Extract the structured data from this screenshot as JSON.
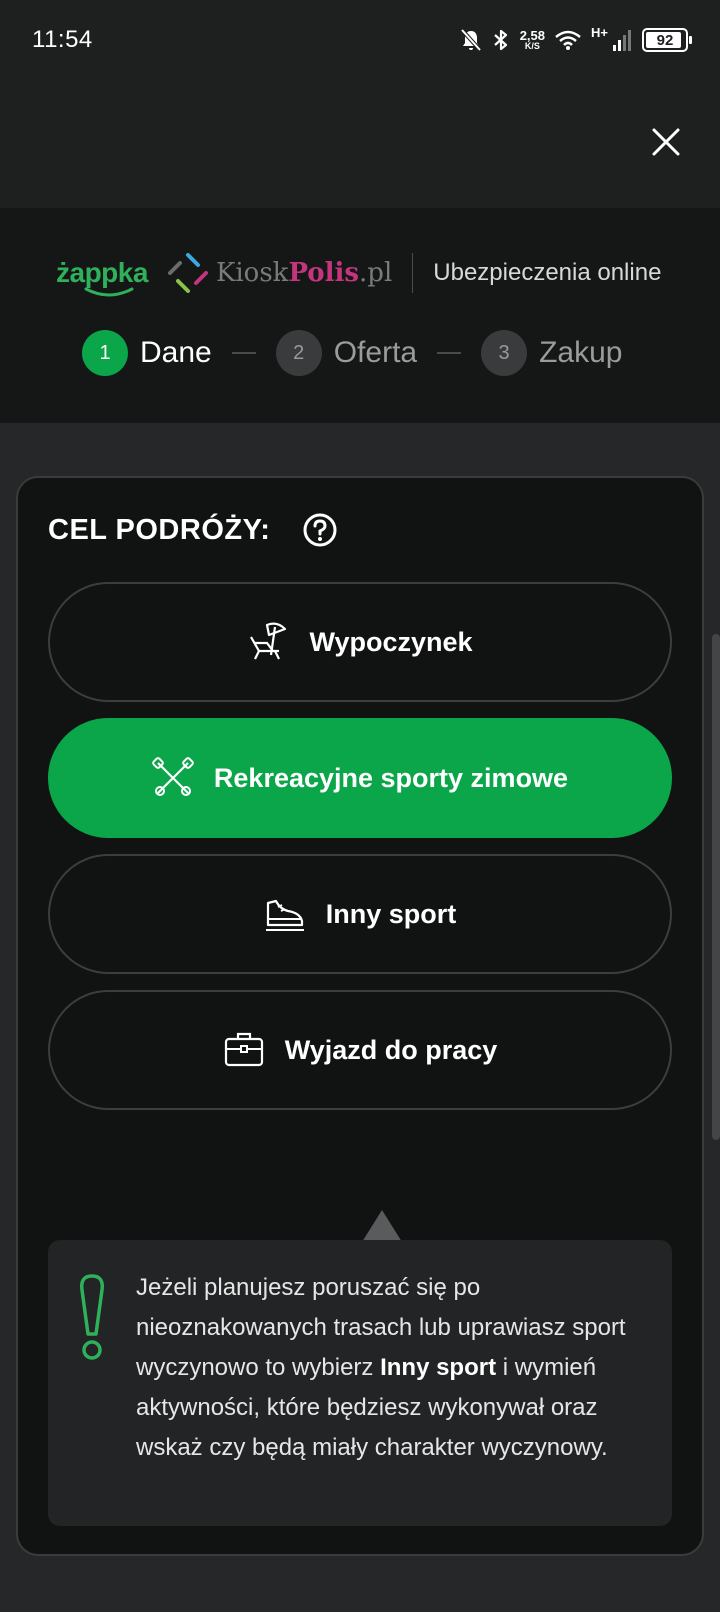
{
  "status_bar": {
    "time": "11:54",
    "net_speed_value": "2,58",
    "net_speed_unit": "K/S",
    "network_type": "H+",
    "battery": "92"
  },
  "header": {
    "brand_zabka": "żappka",
    "brand_kiosk": "Kiosk",
    "brand_polis": "Polis",
    "brand_pl": ".pl",
    "tagline": "Ubezpieczenia online"
  },
  "stepper": {
    "steps": [
      {
        "num": "1",
        "label": "Dane"
      },
      {
        "num": "2",
        "label": "Oferta"
      },
      {
        "num": "3",
        "label": "Zakup"
      }
    ]
  },
  "card": {
    "title": "CEL PODRÓŻY:",
    "options": [
      {
        "label": "Wypoczynek",
        "icon": "beach-chair-icon"
      },
      {
        "label": "Rekreacyjne sporty zimowe",
        "icon": "ski-poles-icon",
        "selected": true
      },
      {
        "label": "Inny sport",
        "icon": "sneaker-icon"
      },
      {
        "label": "Wyjazd do pracy",
        "icon": "briefcase-icon"
      }
    ],
    "tip": {
      "part1": "Jeżeli planujesz poruszać się po nieoznakowanych trasach lub uprawiasz sport wyczynowo to wybierz ",
      "bold": "Inny sport",
      "part2": " i wymień aktywności, które będziesz wykonywał oraz wskaż czy będą miały charakter wyczynowy."
    }
  },
  "colors": {
    "accent": "#0ba54a",
    "brand_green": "#2fb05a",
    "brand_pink": "#c4357d"
  }
}
